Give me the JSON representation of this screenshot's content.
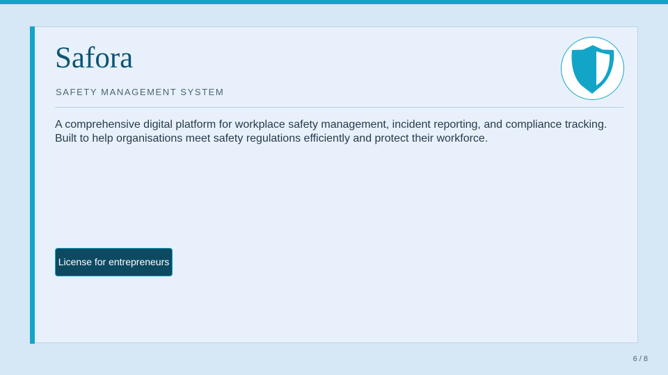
{
  "header": {
    "title": "Safora",
    "subtitle": "SAFETY MANAGEMENT SYSTEM"
  },
  "main": {
    "description": "A comprehensive digital platform for workplace safety management, incident reporting, and compliance tracking. Built to help organisations meet safety regulations efficiently and protect their workforce.",
    "cta_label": "License for entrepreneurs"
  },
  "footer": {
    "page_indicator": "6 / 8"
  },
  "logo": {
    "icon": "shield-icon"
  },
  "colors": {
    "accent": "#13a5c8",
    "title": "#0c5576",
    "button": "#0c4a62",
    "background": "#d6e7f6",
    "card": "#e8f1fb"
  }
}
